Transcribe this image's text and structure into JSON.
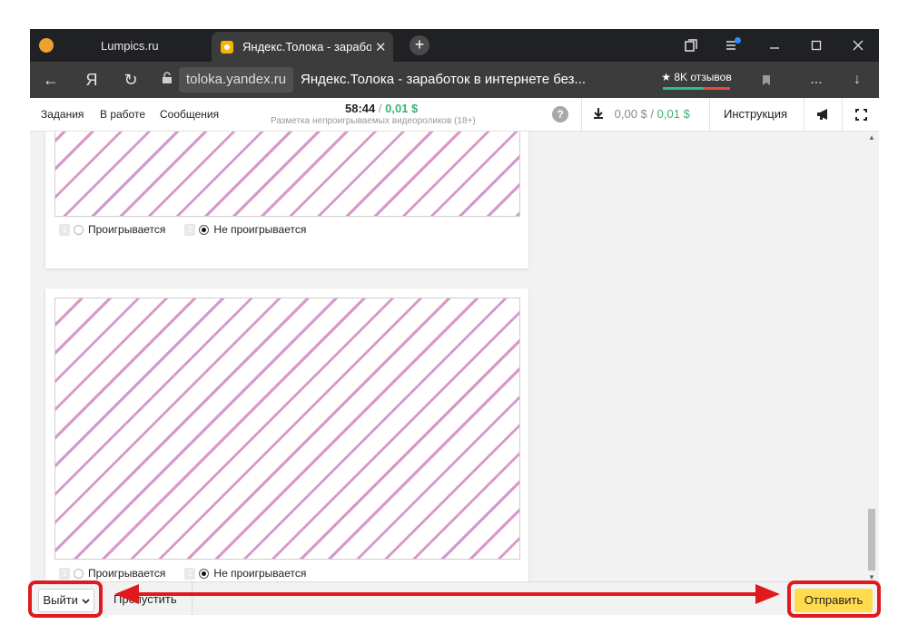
{
  "browser": {
    "tabs": [
      {
        "title": "Lumpics.ru",
        "active": false
      },
      {
        "title": "Яндекс.Толока - зарабо",
        "active": true
      }
    ],
    "new_tab": "+",
    "url": "toloka.yandex.ru",
    "page_title": "Яндекс.Толока - заработок в интернете без...",
    "reviews": "★ 8K отзывов",
    "yandex_logo": "Я",
    "menu": "...",
    "icons": {
      "back": "←",
      "reload": "↻",
      "lock": "🔓",
      "bookmark": "bookmark-icon",
      "download": "↓",
      "close": "✕",
      "minimize": "—",
      "maximize": "☐"
    }
  },
  "toloka_header": {
    "nav": [
      "Задания",
      "В работе",
      "Сообщения"
    ],
    "timer": "58:44",
    "separator": "/",
    "price": "0,01 $",
    "task_title": "Разметка непроигрываемых видеороликов (18+)",
    "help": "?",
    "balance_pending": "0,00 $",
    "balance_sep": "/",
    "balance_available": "0,01 $",
    "instructions": "Инструкция"
  },
  "tasks": [
    {
      "options": [
        {
          "num": "1",
          "label": "Проигрывается",
          "checked": false
        },
        {
          "num": "2",
          "label": "Не проигрывается",
          "checked": true
        }
      ]
    },
    {
      "options": [
        {
          "num": "1",
          "label": "Проигрывается",
          "checked": false
        },
        {
          "num": "2",
          "label": "Не проигрывается",
          "checked": true
        }
      ]
    }
  ],
  "footer": {
    "exit_label": "Выйти",
    "skip_label": "Пропустить",
    "submit_label": "Отправить"
  },
  "colors": {
    "accent_yellow": "#ffdb4d",
    "price_green": "#3cb371",
    "annotation_red": "#e0191f",
    "stripe_pink": "#d898c8"
  }
}
